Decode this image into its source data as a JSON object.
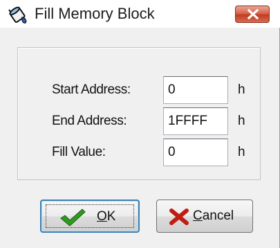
{
  "window": {
    "title": "Fill Memory Block",
    "title_icon": "fill-bucket-icon",
    "close_icon": "close-icon"
  },
  "form": {
    "start_address": {
      "label": "Start Address:",
      "value": "0",
      "suffix": "h"
    },
    "end_address": {
      "label": "End Address:",
      "value": "1FFFF",
      "suffix": "h"
    },
    "fill_value": {
      "label": "Fill Value:",
      "value": "0",
      "suffix": "h"
    }
  },
  "buttons": {
    "ok": {
      "mnemonic": "O",
      "rest": "K",
      "icon": "checkmark-icon"
    },
    "cancel": {
      "mnemonic": "C",
      "rest": "ancel",
      "icon": "x-icon"
    }
  },
  "colors": {
    "close_button": "#c13c23",
    "ok_check": "#2e9a1f",
    "cancel_x": "#c01c12",
    "focus_border": "#3c7fb1"
  }
}
